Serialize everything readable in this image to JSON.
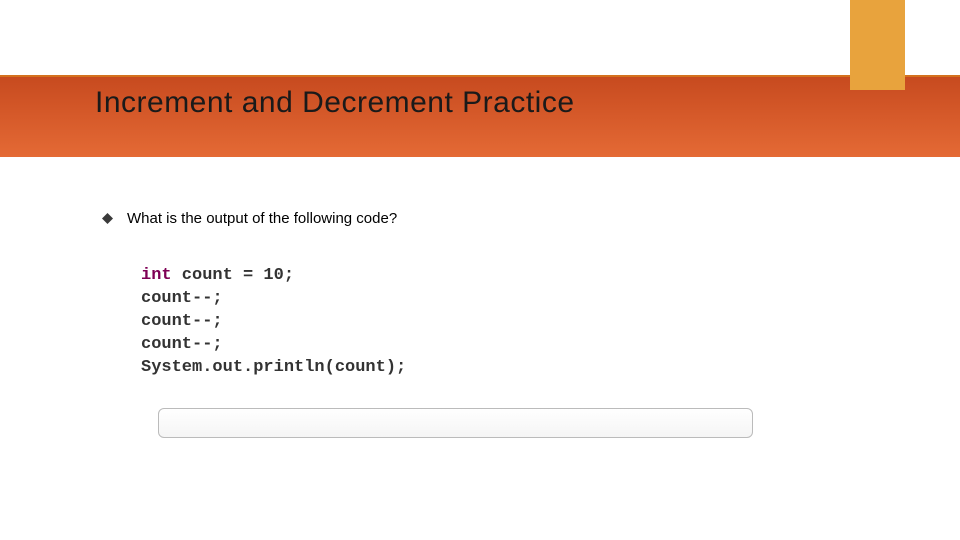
{
  "slide": {
    "title": "Increment and Decrement Practice",
    "bullet": "What is the output of the following code?",
    "code": {
      "line1_kw": "int",
      "line1_rest": " count = 10;",
      "line2": "count--;",
      "line3": "count--;",
      "line4": "count--;",
      "line5": "System.out.println(count);"
    },
    "answer": ""
  }
}
